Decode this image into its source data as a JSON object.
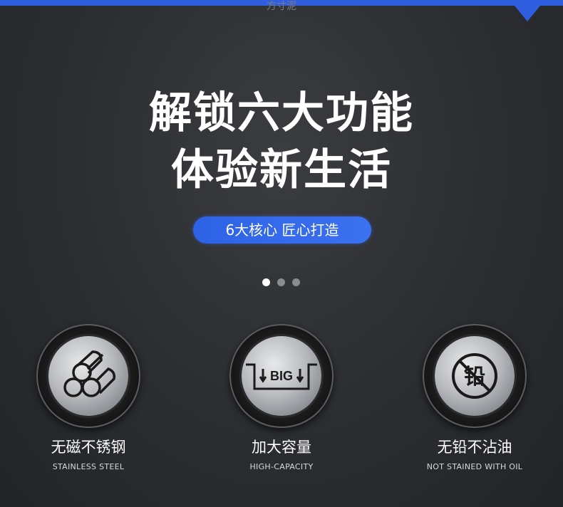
{
  "watermark": "方寸泥",
  "headline": {
    "line1": "解锁六大功能",
    "line2": "体验新生活"
  },
  "pill_label": "6大核心  匠心打造",
  "carousel": {
    "count": 3,
    "active_index": 0
  },
  "features": [
    {
      "title": "无磁不锈钢",
      "subtitle": "STAINLESS STEEL",
      "icon": "pipes-icon"
    },
    {
      "title": "加大容量",
      "subtitle": "HIGH-CAPACITY",
      "icon": "big-pot-icon",
      "icon_text": "BIG"
    },
    {
      "title": "无铅不沾油",
      "subtitle": "NOT STAINED WITH OIL",
      "icon": "no-lead-icon",
      "icon_text": "铅"
    }
  ],
  "colors": {
    "accent": "#2f5fe0",
    "background": "#2b2d31"
  }
}
